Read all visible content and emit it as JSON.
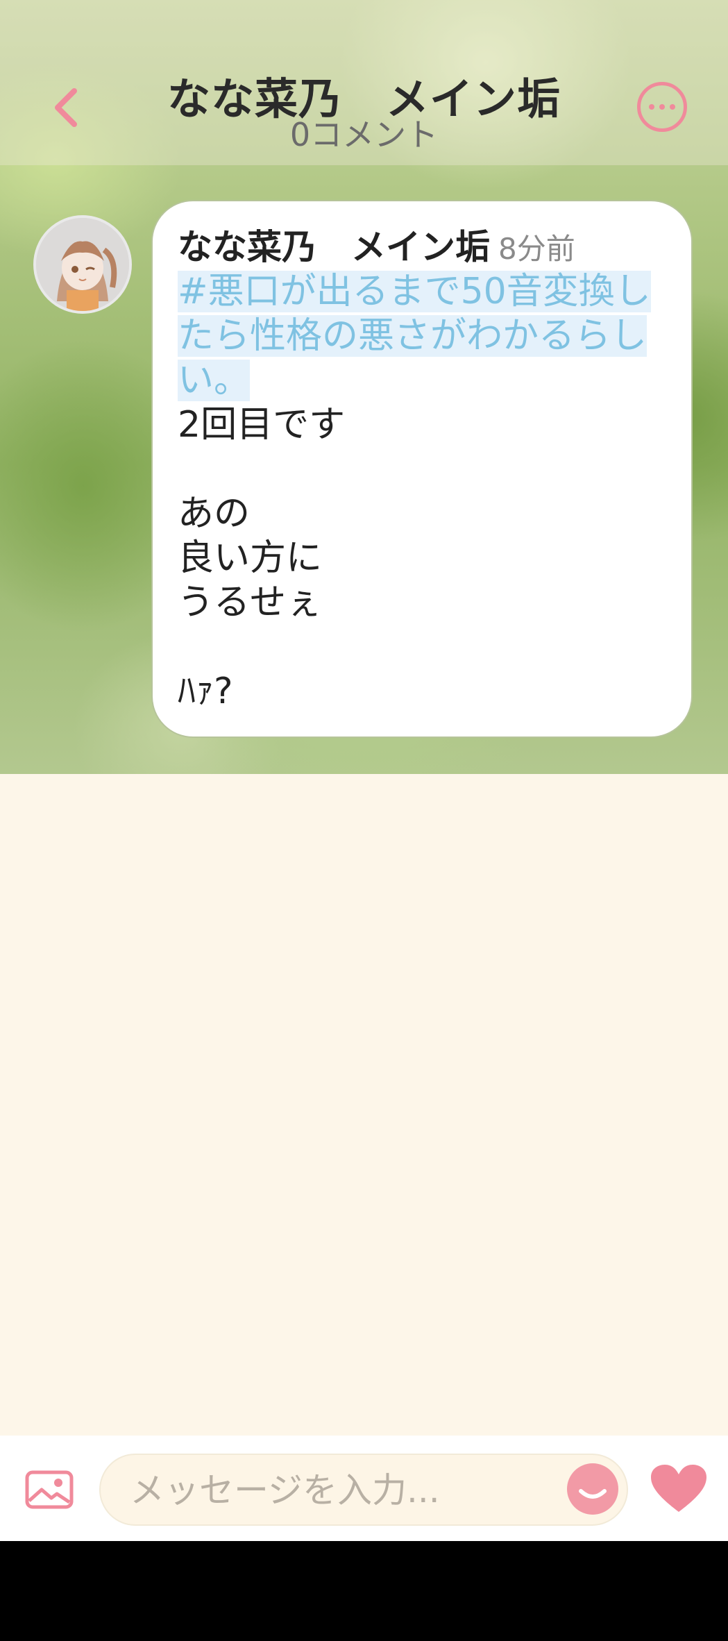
{
  "header": {
    "title": "なな菜乃　メイン垢",
    "subtitle": "0コメント",
    "back_icon": "chevron-left-icon",
    "more_icon": "more-horizontal-icon"
  },
  "post": {
    "author": "なな菜乃　メイン垢",
    "time": "8分前",
    "hashtag": "#悪口が出るまで50音変換したら性格の悪さがわかるらしい。",
    "lines": [
      "2回目です",
      "",
      "あの",
      "良い方に",
      "うるせぇ",
      "",
      "ﾊｧ?"
    ]
  },
  "composer": {
    "placeholder": "メッセージを入力...",
    "image_icon": "image-icon",
    "emoji_icon": "smile-icon",
    "like_icon": "heart-icon"
  },
  "colors": {
    "accent": "#f08a9b",
    "hashtag": "#7fc2e2",
    "background": "#fdf6e9"
  }
}
